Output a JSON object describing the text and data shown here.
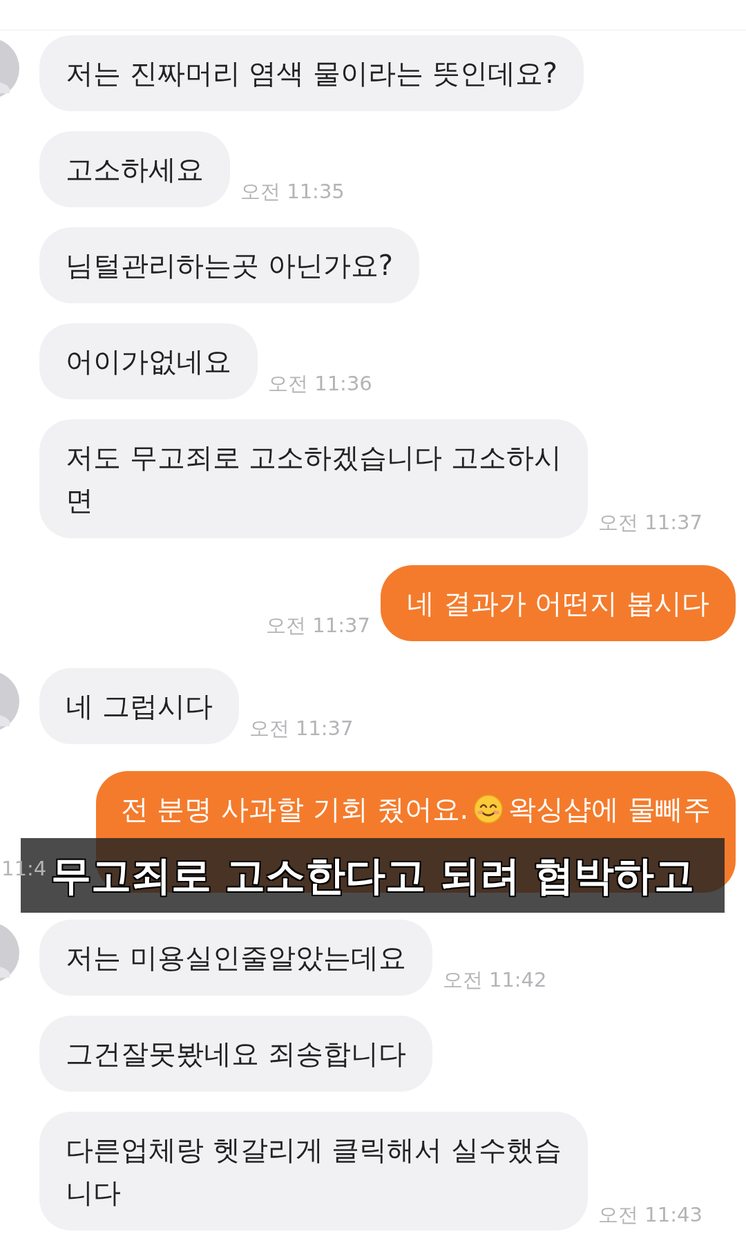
{
  "messages": [
    {
      "kind": "received",
      "avatar": true,
      "text": "저는 진짜머리 염색 물이라는 뜻인데요?"
    },
    {
      "kind": "received",
      "avatar": false,
      "text": "고소하세요",
      "time": "오전 11:35"
    },
    {
      "kind": "received",
      "avatar": false,
      "text": "님털관리하는곳 아닌가요?"
    },
    {
      "kind": "received",
      "avatar": false,
      "text": "어이가없네요",
      "time": "오전 11:36"
    },
    {
      "kind": "received",
      "avatar": false,
      "text": "저도 무고죄로 고소하겠습니다 고소하시\n면",
      "time": "오전 11:37"
    },
    {
      "kind": "sent",
      "text": "네 결과가 어떤지 봅시다",
      "time": "오전 11:37"
    },
    {
      "kind": "received",
      "avatar": true,
      "text": "네 그럽시다",
      "time": "오전 11:37"
    },
    {
      "kind": "sent",
      "segments": [
        {
          "kind": "text",
          "text": "전 분명 사과할 기회 줬어요."
        },
        {
          "kind": "emoji"
        },
        {
          "kind": "text",
          "text": "왁싱샵에 물빼주"
        }
      ],
      "time": "11:4"
    },
    {
      "kind": "received",
      "avatar": true,
      "text": "저는 미용실인줄알았는데요",
      "time": "오전 11:42"
    },
    {
      "kind": "received",
      "avatar": false,
      "text": "그건잘못봤네요 죄송합니다"
    },
    {
      "kind": "received",
      "avatar": false,
      "text": "다른업체랑 헷갈리게 클릭해서 실수했습\n니다",
      "time": "오전 11:43"
    }
  ],
  "subtitle": {
    "text": "무고죄로 고소한다고 되려 협박하고"
  }
}
